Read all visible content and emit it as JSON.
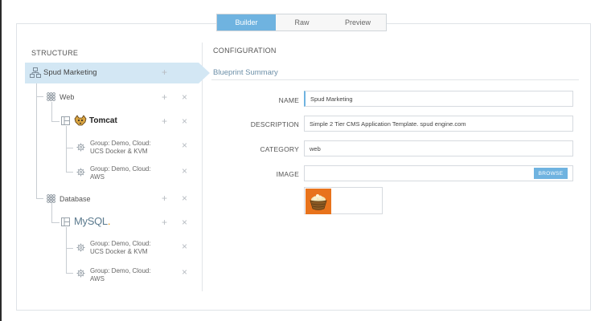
{
  "tabs": [
    {
      "label": "Builder",
      "active": true
    },
    {
      "label": "Raw",
      "active": false
    },
    {
      "label": "Preview",
      "active": false
    }
  ],
  "structure": {
    "title": "STRUCTURE",
    "root": {
      "label": "Spud Marketing",
      "icon": "hierarchy-icon"
    },
    "tiers": [
      {
        "label": "Web",
        "icon": "tier-grid-icon",
        "component": {
          "label": "Tomcat",
          "icon": "tomcat-logo"
        },
        "nodes": [
          {
            "line1": "Group: Demo, Cloud:",
            "line2": "UCS Docker & KVM"
          },
          {
            "line1": "Group: Demo, Cloud:",
            "line2": "AWS"
          }
        ]
      },
      {
        "label": "Database",
        "icon": "tier-grid-icon",
        "component": {
          "label_main": "MySQL",
          "label_dot": ".",
          "icon": "mysql-logo"
        },
        "nodes": [
          {
            "line1": "Group: Demo, Cloud:",
            "line2": "UCS Docker & KVM"
          },
          {
            "line1": "Group: Demo, Cloud:",
            "line2": "AWS"
          }
        ]
      }
    ],
    "add_symbol": "+",
    "remove_symbol": "×"
  },
  "configuration": {
    "title": "CONFIGURATION",
    "subtitle": "Blueprint Summary",
    "fields": {
      "name": {
        "label": "NAME",
        "value": "Spud Marketing"
      },
      "description": {
        "label": "DESCRIPTION",
        "value": "Simple 2 Tier CMS Application Template. spud engine.com"
      },
      "category": {
        "label": "CATEGORY",
        "value": "web"
      },
      "image": {
        "label": "IMAGE",
        "value": "",
        "browse_label": "BROWSE"
      }
    }
  },
  "colors": {
    "accent": "#6fb3e0",
    "selected_row": "#d3e7f4",
    "tomcat_brand": "#222222",
    "mysql_text": "#5b7a8e",
    "mysql_dot": "#e48e00",
    "thumb_bg": "#e8731c"
  }
}
